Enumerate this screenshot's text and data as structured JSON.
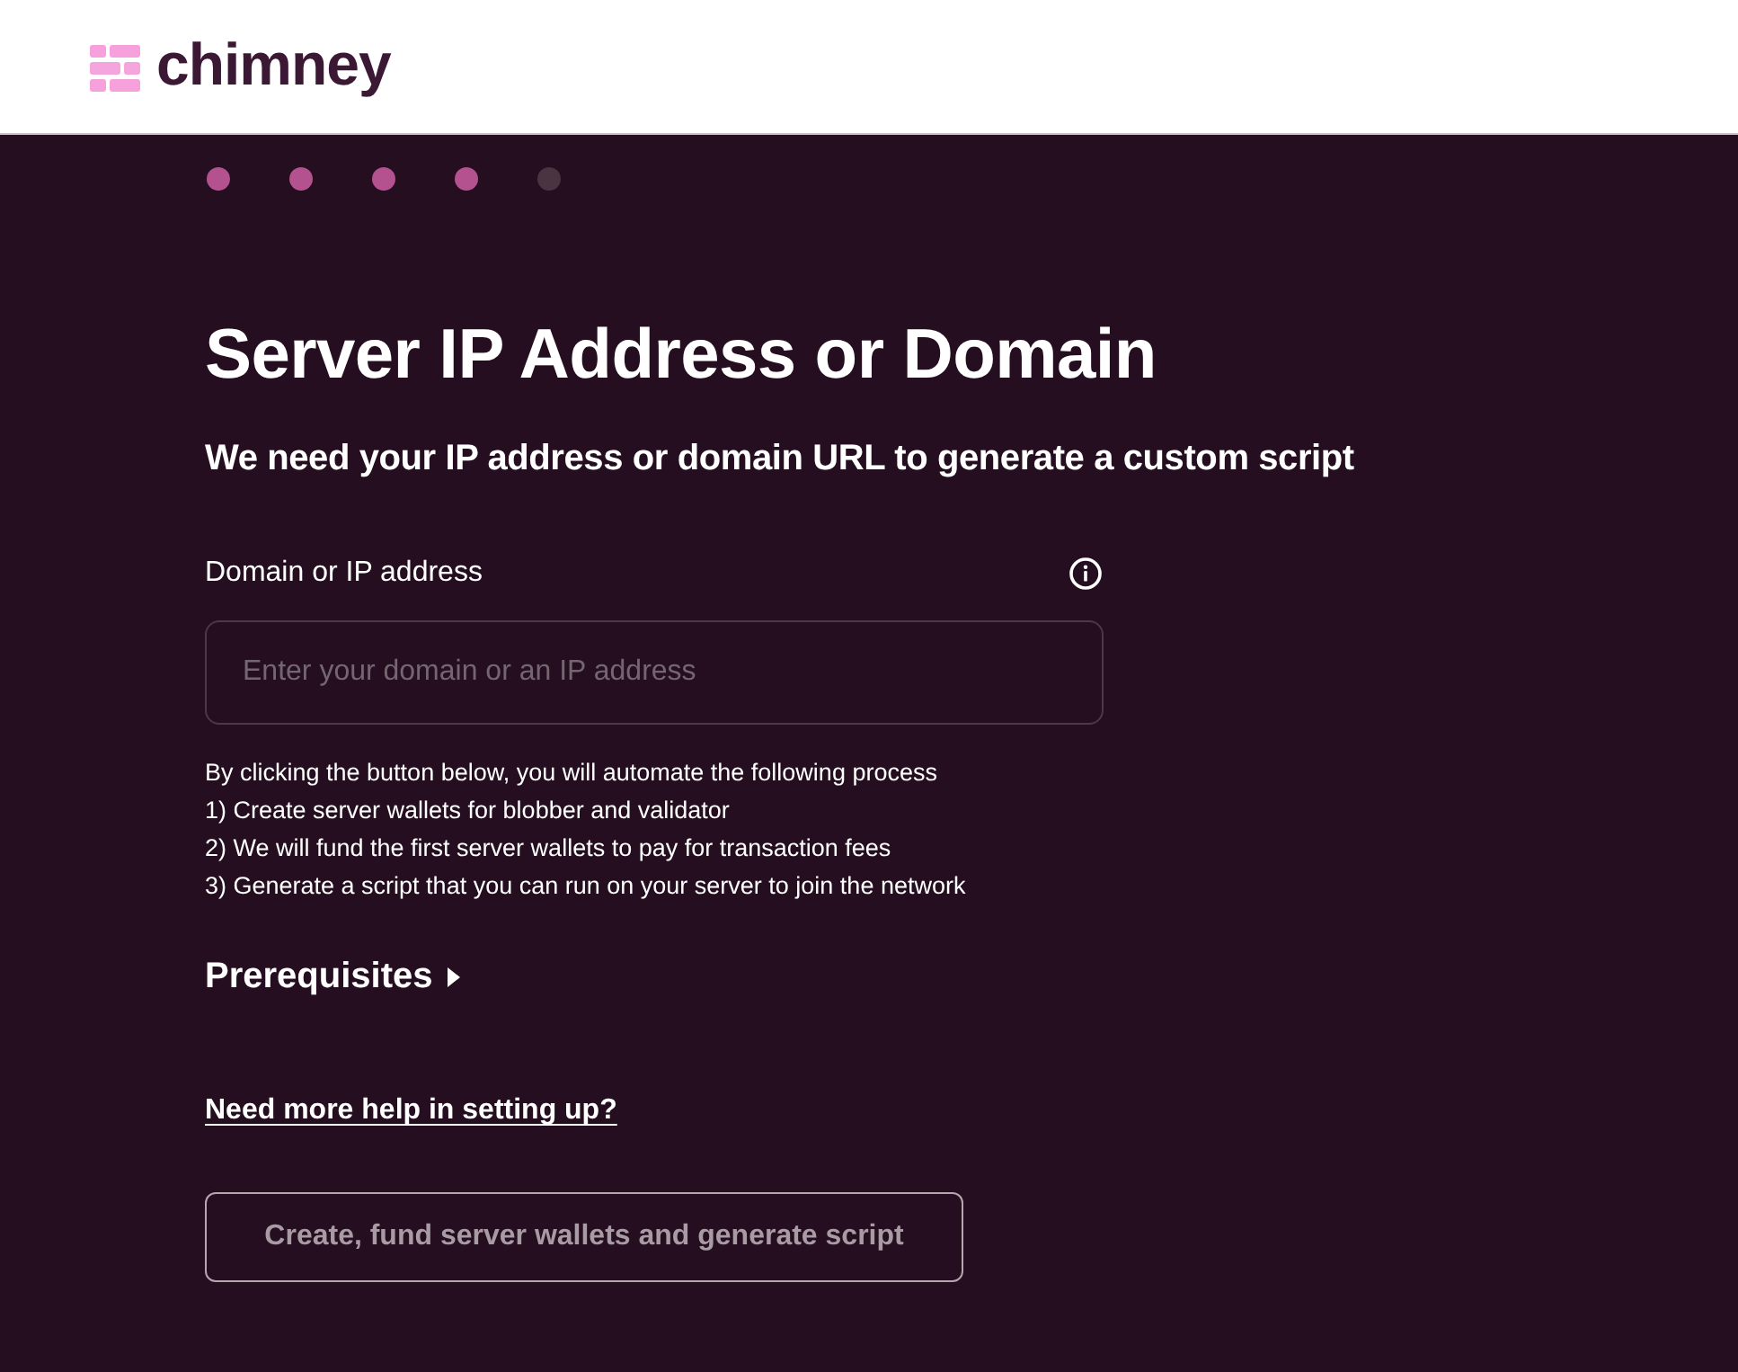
{
  "header": {
    "logo_text": "chimney"
  },
  "steps": [
    {
      "completed": true
    },
    {
      "completed": true
    },
    {
      "completed": true
    },
    {
      "completed": true
    },
    {
      "completed": false
    }
  ],
  "title": "Server IP Address or Domain",
  "subtitle": "We need your IP address or domain URL to generate a custom script",
  "field": {
    "label": "Domain or IP address",
    "placeholder": "Enter your domain or an IP address"
  },
  "process": {
    "intro": "By clicking the button below, you will automate the following process",
    "items": [
      "1) Create server wallets for blobber and validator",
      "2) We will fund the first server wallets to pay for transaction fees",
      "3) Generate a script that you can run on your server to join the network"
    ]
  },
  "prerequisites": {
    "label": "Prerequisites",
    "expanded": false
  },
  "help_link": "Need more help in setting up?",
  "submit_button": {
    "label": "Create, fund server wallets and generate script",
    "disabled": true
  }
}
